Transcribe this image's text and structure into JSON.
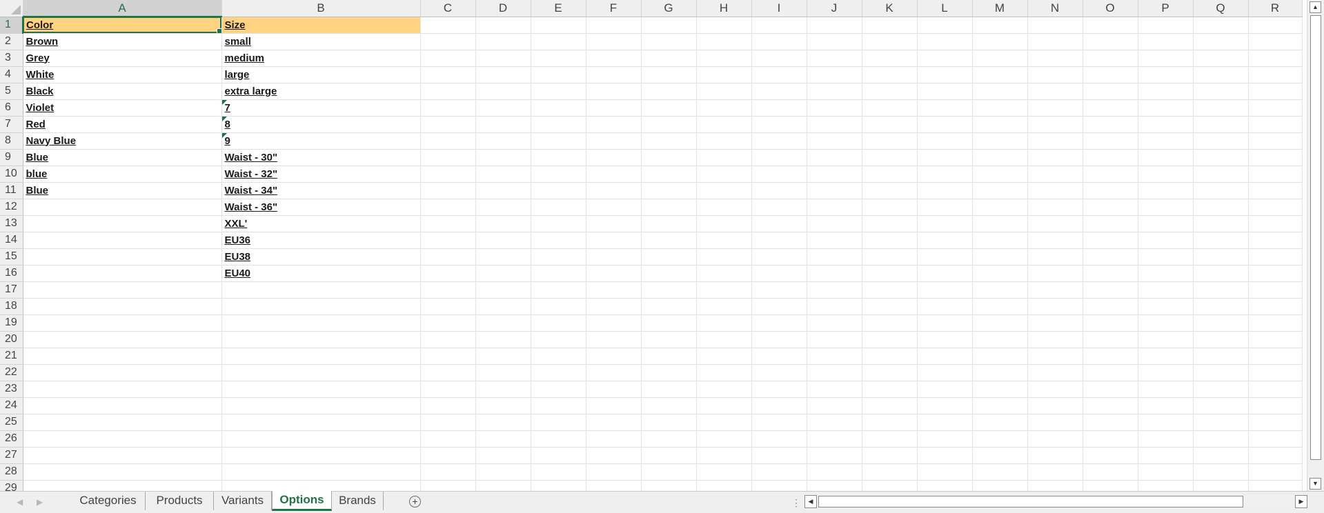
{
  "spreadsheet": {
    "columns": [
      "A",
      "B",
      "C",
      "D",
      "E",
      "F",
      "G",
      "H",
      "I",
      "J",
      "K",
      "L",
      "M",
      "N",
      "O",
      "P",
      "Q",
      "R"
    ],
    "row_numbers": [
      1,
      2,
      3,
      4,
      5,
      6,
      7,
      8,
      9,
      10,
      11,
      12,
      13,
      14,
      15,
      16,
      17,
      18,
      19,
      20,
      21,
      22,
      23,
      24,
      25,
      26,
      27,
      28,
      29
    ],
    "selected_column": "A",
    "selected_row": 1,
    "active_cell": "A1",
    "header_fill_color": "#ffd37f",
    "accent_color": "#217346",
    "cells": {
      "A": [
        "Color",
        "Brown",
        "Grey",
        "White",
        "Black",
        "Violet",
        "Red",
        "Navy Blue",
        "Blue",
        "blue ",
        "Blue  "
      ],
      "B": [
        "Size",
        "small",
        "medium",
        "large",
        "extra large",
        "7",
        "8",
        "9",
        "Waist - 30\"",
        "Waist - 32\"",
        "Waist - 34\"",
        "Waist - 36\"",
        "XXL'",
        "EU36",
        "EU38",
        "EU40"
      ]
    },
    "number_stored_as_text_rows": [
      6,
      7,
      8
    ]
  },
  "sheet_tabs": {
    "tabs": [
      "Categories",
      "Products",
      "Variants",
      "Options",
      "Brands"
    ],
    "active_tab": "Options",
    "add_sheet_icon": "plus-circle-icon",
    "prev_icon": "chevron-left-icon",
    "next_icon": "chevron-right-icon"
  },
  "icons": {
    "scroll_up": "▲",
    "scroll_down": "▼",
    "scroll_left": "◀",
    "scroll_right": "▶",
    "nav_prev": "◀",
    "nav_next": "▶",
    "add_sheet": "+",
    "splitter": "⋮"
  }
}
